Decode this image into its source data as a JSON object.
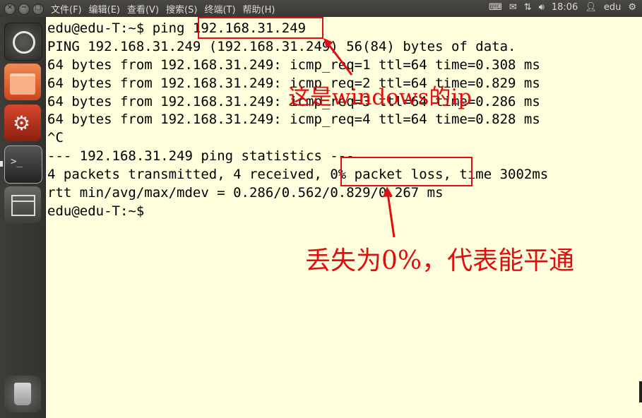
{
  "menubar": [
    "文件(F)",
    "编辑(E)",
    "查看(V)",
    "搜索(S)",
    "终端(T)",
    "帮助(H)"
  ],
  "tray": {
    "clock": "18:06",
    "user": "edu"
  },
  "terminal_lines": [
    "edu@edu-T:~$ ping 192.168.31.249",
    "PING 192.168.31.249 (192.168.31.249) 56(84) bytes of data.",
    "64 bytes from 192.168.31.249: icmp_req=1 ttl=64 time=0.308 ms",
    "64 bytes from 192.168.31.249: icmp_req=2 ttl=64 time=0.829 ms",
    "64 bytes from 192.168.31.249: icmp_req=3 ttl=64 time=0.286 ms",
    "64 bytes from 192.168.31.249: icmp_req=4 ttl=64 time=0.828 ms",
    "^C",
    "--- 192.168.31.249 ping statistics ---",
    "4 packets transmitted, 4 received, 0% packet loss, time 3002ms",
    "rtt min/avg/max/mdev = 0.286/0.562/0.829/0.267 ms",
    "edu@edu-T:~$"
  ],
  "annotations": {
    "ip_note": "这是windows的ip",
    "loss_note": "丢失为0%，代表能平通"
  },
  "colors": {
    "annotation": "#e30d10",
    "terminal_bg": "#fffedd"
  }
}
